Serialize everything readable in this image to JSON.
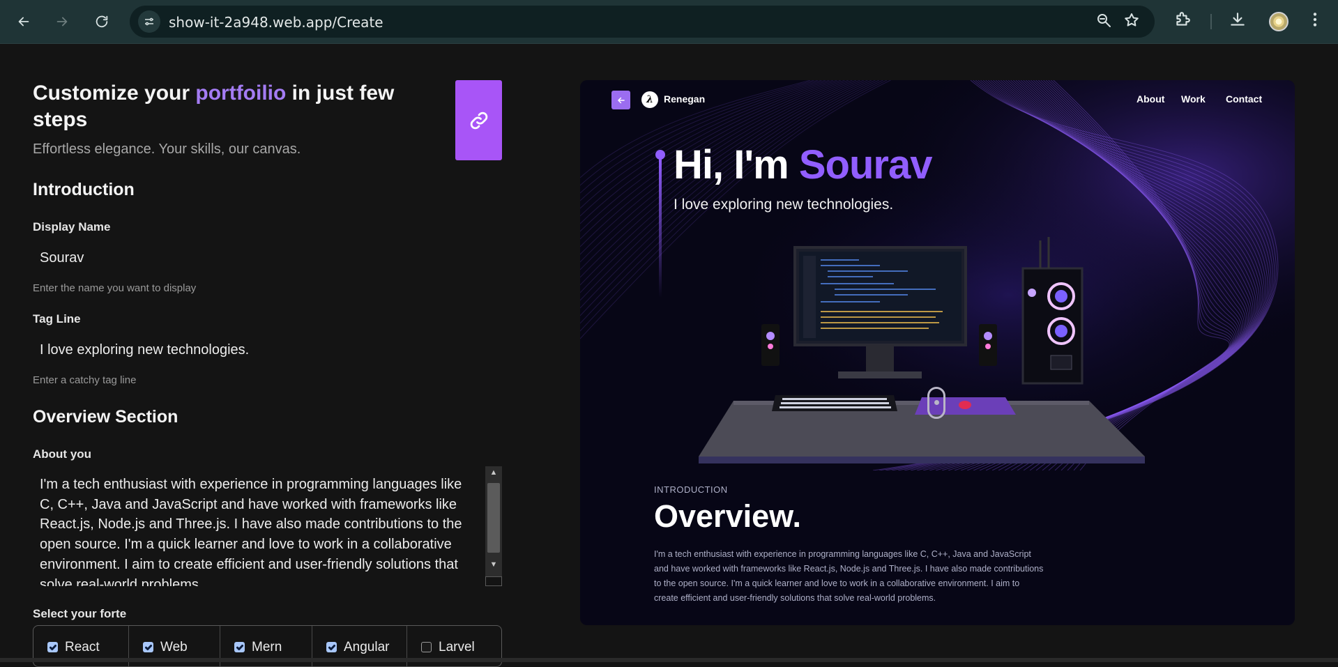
{
  "browser": {
    "url": "show-it-2a948.web.app/Create",
    "icons": [
      "back-arrow-icon",
      "forward-arrow-icon",
      "reload-icon",
      "site-info-icon",
      "zoom-icon",
      "bookmark-star-icon",
      "extensions-icon",
      "download-icon",
      "profile-avatar",
      "menu-dots-icon"
    ]
  },
  "form": {
    "title_prefix": "Customize your ",
    "title_accent": "portfoilio",
    "title_suffix": " in just few steps",
    "subtitle": "Effortless elegance. Your skills, our canvas.",
    "introduction_heading": "Introduction",
    "display_name_label": "Display Name",
    "display_name_value": "Sourav",
    "display_name_help": "Enter the name you want to display",
    "tagline_label": "Tag Line",
    "tagline_value": "I love exploring new technologies.",
    "tagline_help": "Enter a catchy tag line",
    "overview_heading": "Overview Section",
    "about_label": "About you",
    "about_value": "I'm a tech enthusiast with experience in programming languages like C, C++, Java and JavaScript and have worked with frameworks like React.js, Node.js and Three.js. I have also made contributions to the open source. I'm a quick learner and love to work in a collaborative environment. I aim to create efficient and user-friendly solutions that solve real-world problems.",
    "forte_label": "Select your forte",
    "forte_options": [
      {
        "label": "React",
        "checked": true
      },
      {
        "label": "Web",
        "checked": true
      },
      {
        "label": "Mern",
        "checked": true
      },
      {
        "label": "Angular",
        "checked": true
      },
      {
        "label": "Larvel",
        "checked": false
      }
    ],
    "accent_color": "#a855f7"
  },
  "preview": {
    "brand": "Renegan",
    "logo_glyph": "λ",
    "nav": [
      "About",
      "Work",
      "Contact"
    ],
    "hero_prefix": "Hi, I'm ",
    "hero_name": "Sourav",
    "tagline": "I love exploring new technologies.",
    "section_kicker": "INTRODUCTION",
    "section_title": "Overview.",
    "about": "I'm a tech enthusiast with experience in programming languages like C, C++, Java and JavaScript and have worked with frameworks like React.js, Node.js and Three.js. I have also made contributions to the open source. I'm a quick learner and love to work in a collaborative environment. I aim to create efficient and user-friendly solutions that solve real-world problems.",
    "accent_color": "#915eff",
    "background_color": "#070616"
  }
}
